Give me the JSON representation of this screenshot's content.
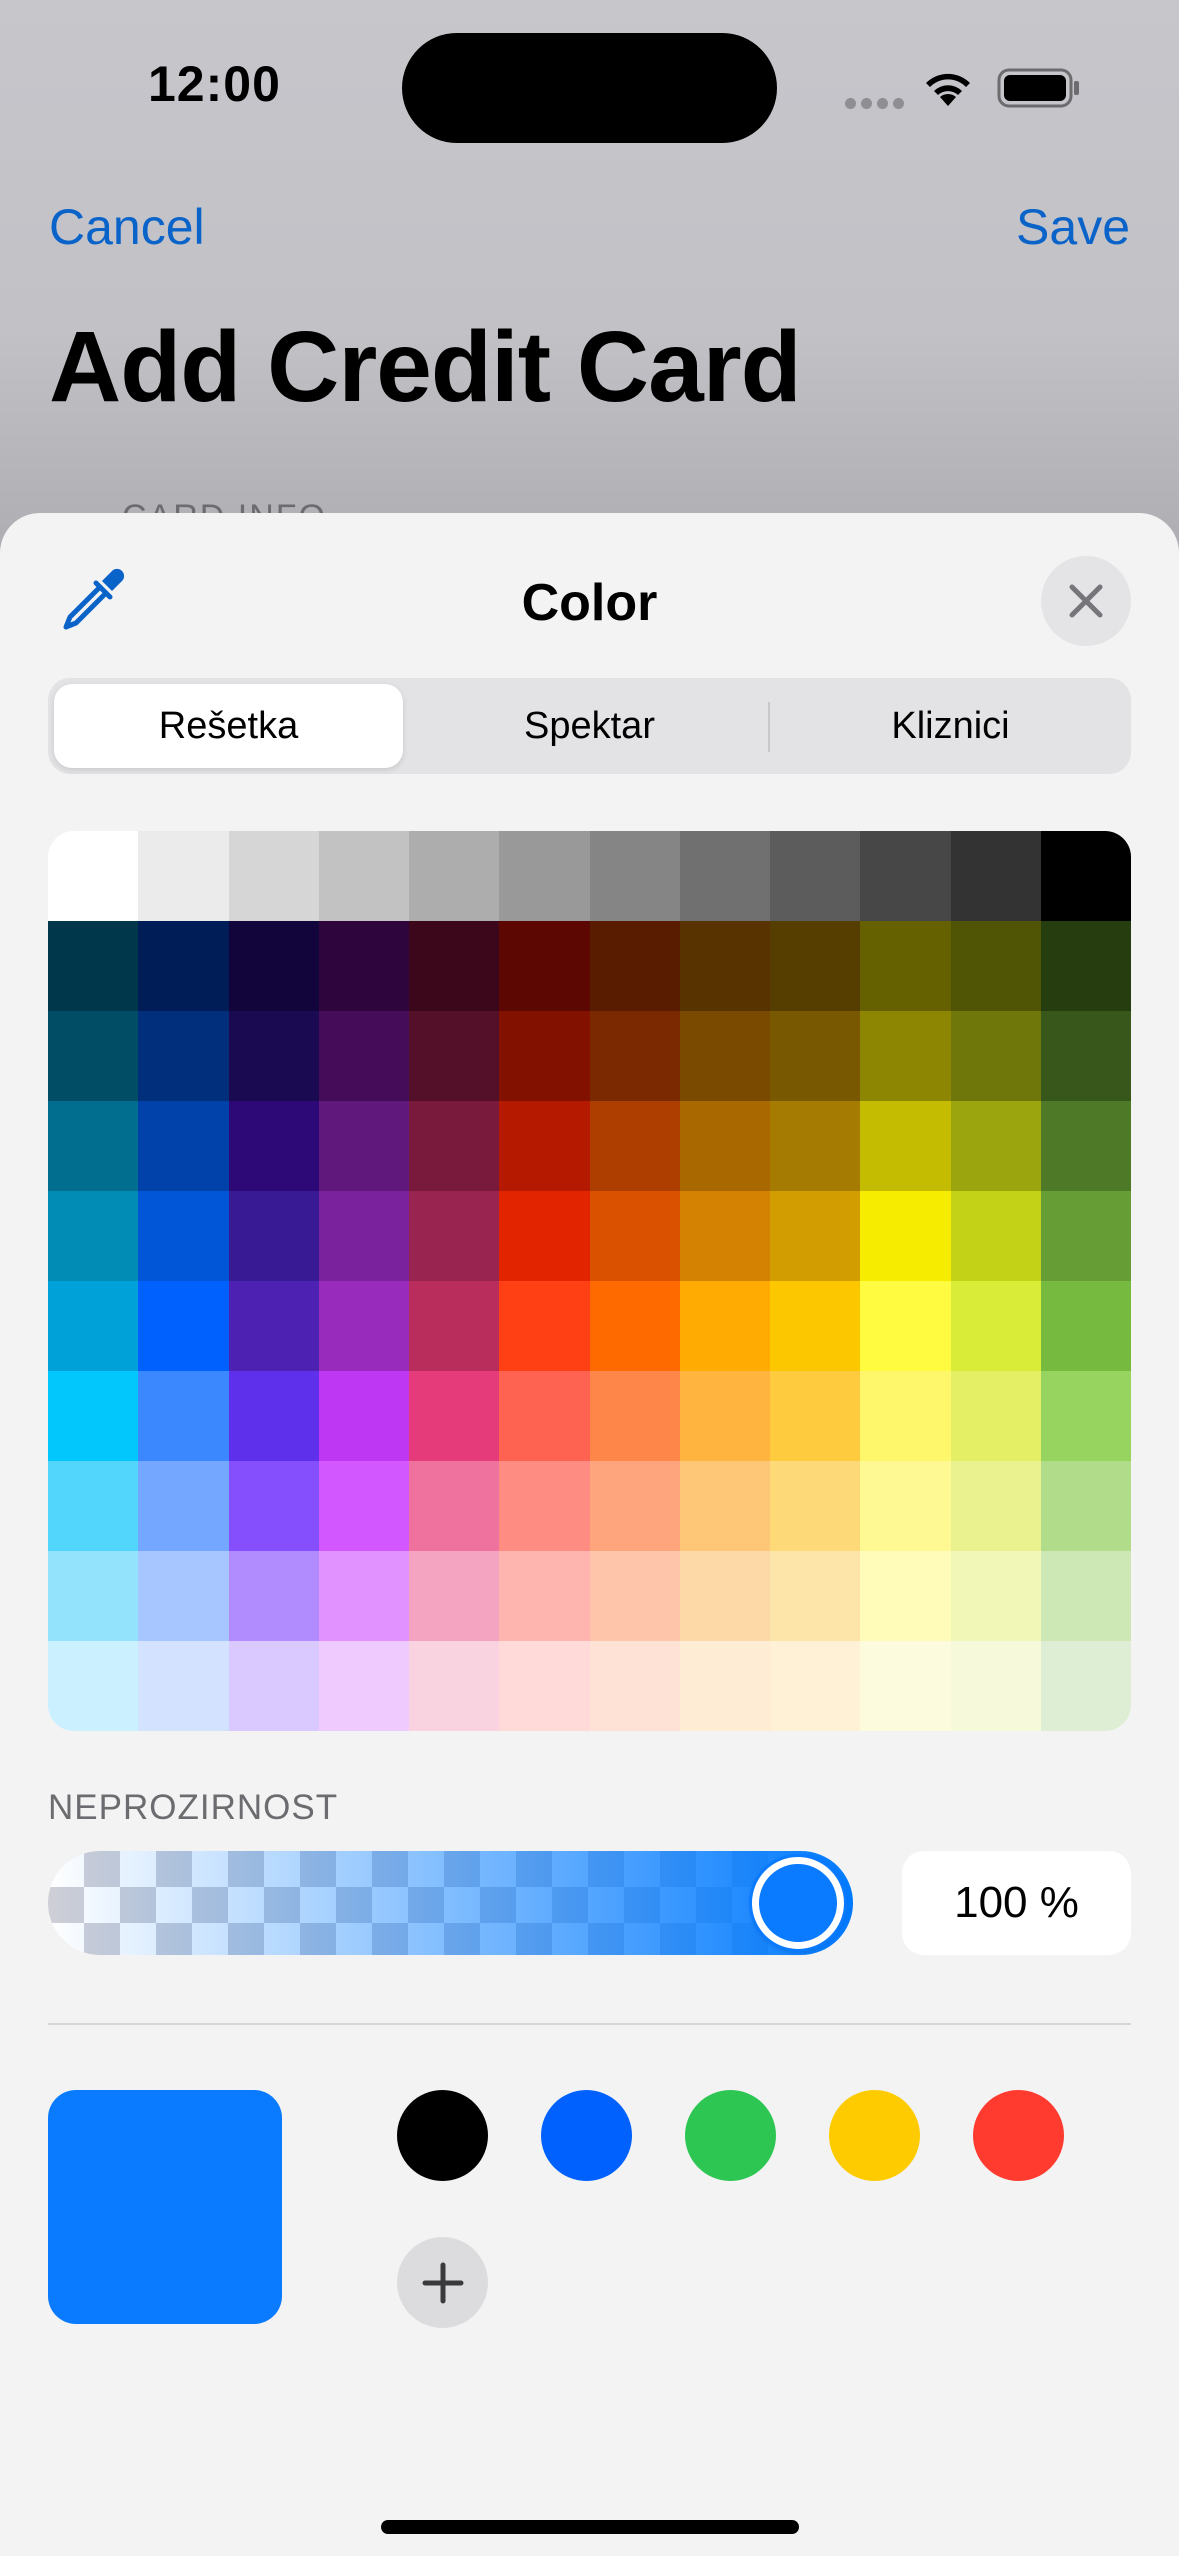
{
  "status_bar": {
    "time": "12:00"
  },
  "background_screen": {
    "cancel": "Cancel",
    "save": "Save",
    "title": "Add Credit Card",
    "section": "CARD INFO"
  },
  "sheet": {
    "title": "Color",
    "tabs": [
      {
        "label": "Rešetka",
        "selected": true
      },
      {
        "label": "Spektar",
        "selected": false
      },
      {
        "label": "Kliznici",
        "selected": false
      }
    ],
    "grid_colors": [
      [
        "#ffffff",
        "#ebebeb",
        "#d6d6d6",
        "#c2c2c2",
        "#adadad",
        "#999999",
        "#858585",
        "#707070",
        "#5c5c5c",
        "#474747",
        "#333333",
        "#000000"
      ],
      [
        "#00374a",
        "#011d57",
        "#11053b",
        "#2e063d",
        "#3c071b",
        "#5c0701",
        "#5a1c00",
        "#583300",
        "#563d00",
        "#666100",
        "#4f5504",
        "#263e0f"
      ],
      [
        "#004d65",
        "#012f7b",
        "#1a0a52",
        "#450d59",
        "#551029",
        "#831100",
        "#7b2900",
        "#7a4a00",
        "#785800",
        "#8c8602",
        "#6f760a",
        "#38571a"
      ],
      [
        "#016e8f",
        "#0042a9",
        "#2c0977",
        "#61187c",
        "#791a3d",
        "#b51a00",
        "#ad3e00",
        "#a96800",
        "#a67b01",
        "#c4bc00",
        "#9ba50e",
        "#4e7a27"
      ],
      [
        "#008cb4",
        "#0056d6",
        "#371a94",
        "#7a219e",
        "#99244f",
        "#e22400",
        "#da5100",
        "#d38301",
        "#d19d01",
        "#f5ec00",
        "#c3d117",
        "#669d34"
      ],
      [
        "#00a1d8",
        "#0061fe",
        "#4d22b2",
        "#982abc",
        "#b92d5d",
        "#ff4015",
        "#ff6a00",
        "#ffab01",
        "#fdc700",
        "#fefb41",
        "#d9ec37",
        "#76bb40"
      ],
      [
        "#01c7fc",
        "#3a87fe",
        "#5e30eb",
        "#be38f3",
        "#e63b7a",
        "#fe6250",
        "#fe8648",
        "#feb43f",
        "#fecb3e",
        "#fff76b",
        "#e4ef65",
        "#96d35f"
      ],
      [
        "#52d6fc",
        "#74a7ff",
        "#864ffe",
        "#d357fe",
        "#ee719e",
        "#ff8c82",
        "#fea57d",
        "#fec777",
        "#fed977",
        "#fff994",
        "#eaf28f",
        "#b1dd8b"
      ],
      [
        "#93e3fc",
        "#a7c6ff",
        "#b18cfe",
        "#e292fe",
        "#f4a4c0",
        "#ffb5af",
        "#ffc5ab",
        "#fed9a8",
        "#fde4a8",
        "#fffbb9",
        "#f1f7b7",
        "#cde8b5"
      ],
      [
        "#cbf0ff",
        "#d3e2ff",
        "#d9c9fe",
        "#efcaff",
        "#f9d3e0",
        "#ffdad8",
        "#ffe2d6",
        "#feecd4",
        "#fef1d5",
        "#fdfbdd",
        "#f6fadb",
        "#deeed4"
      ]
    ],
    "opacity": {
      "label": "NEPROZIRNOST",
      "value_text": "100 %",
      "value": 1.0
    },
    "current_color": "#0a7aff",
    "accent_color": "#0a63c9",
    "swatches": [
      {
        "name": "black",
        "color": "#000000"
      },
      {
        "name": "blue",
        "color": "#0061fe"
      },
      {
        "name": "green",
        "color": "#2dc653"
      },
      {
        "name": "yellow",
        "color": "#fecb00"
      },
      {
        "name": "red",
        "color": "#ff3b30"
      }
    ],
    "icons": {
      "eyedropper": "eyedropper-icon",
      "close": "close-icon",
      "add": "plus-icon"
    }
  }
}
